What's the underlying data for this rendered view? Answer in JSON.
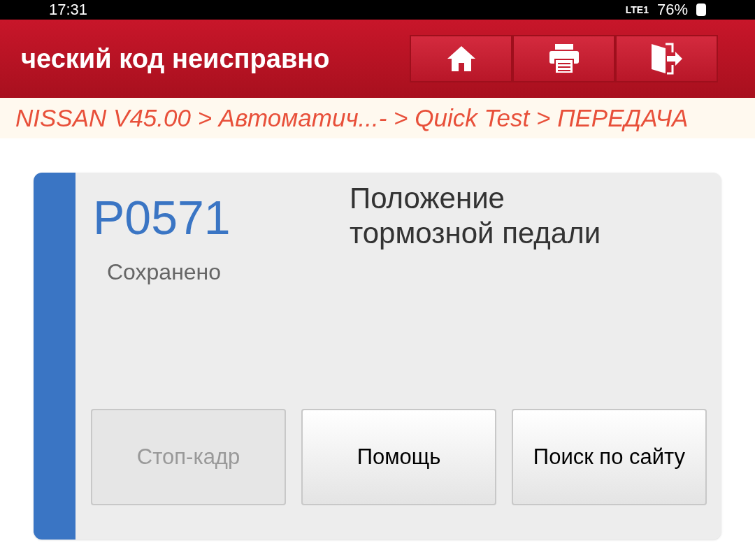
{
  "status_bar": {
    "time": "17:31",
    "network": "LTE1",
    "battery": "76%"
  },
  "header": {
    "title": "ческий код неисправно",
    "buttons": [
      {
        "kind": "home"
      },
      {
        "kind": "print"
      },
      {
        "kind": "exit"
      }
    ]
  },
  "breadcrumb": "NISSAN V45.00 > Автоматич...- > Quick Test > ПЕРЕДАЧА",
  "dtc": {
    "code": "P0571",
    "status": "Сохранено",
    "description": "Положение тормозной педали",
    "buttons": [
      {
        "label": "Стоп-кадр",
        "disabled": true
      },
      {
        "label": "Помощь",
        "disabled": false
      },
      {
        "label": "Поиск по сайту",
        "disabled": false
      }
    ]
  }
}
